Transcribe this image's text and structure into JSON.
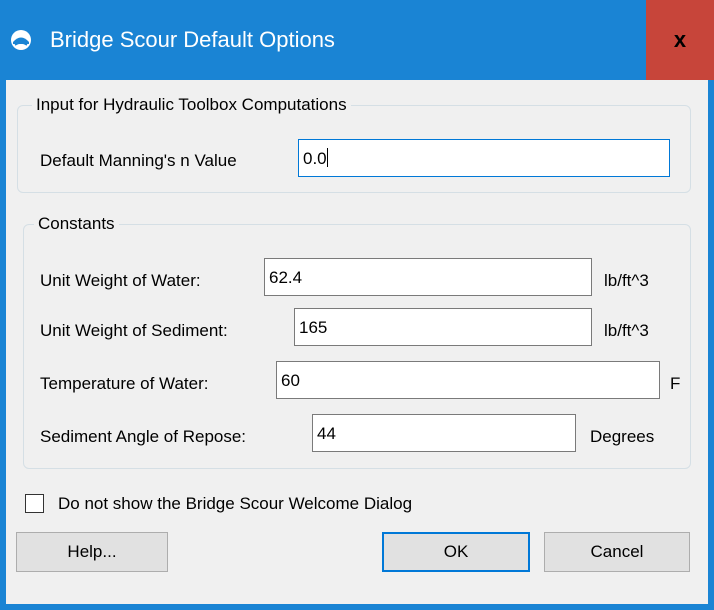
{
  "window": {
    "title": "Bridge Scour Default Options",
    "close_glyph": "x",
    "app_icon": "bridge-scour-app-icon"
  },
  "hydraulic_group": {
    "title": "Input for Hydraulic Toolbox Computations",
    "mannings_label": "Default Manning's n Value",
    "mannings_value": "0.0"
  },
  "constants_group": {
    "title": "Constants",
    "rows": [
      {
        "label": "Unit Weight of Water:",
        "value": "62.4",
        "unit": "lb/ft^3"
      },
      {
        "label": "Unit Weight of Sediment:",
        "value": "165",
        "unit": "lb/ft^3"
      },
      {
        "label": "Temperature of Water:",
        "value": "60",
        "unit": "F"
      },
      {
        "label": "Sediment Angle of Repose:",
        "value": "44",
        "unit": "Degrees"
      }
    ]
  },
  "welcome_checkbox": {
    "label": "Do not show the Bridge Scour Welcome Dialog",
    "checked": false
  },
  "buttons": {
    "help": "Help...",
    "ok": "OK",
    "cancel": "Cancel"
  },
  "colors": {
    "titlebar": "#1a84d4",
    "close_button": "#c7453a",
    "background": "#f0f0f0"
  }
}
